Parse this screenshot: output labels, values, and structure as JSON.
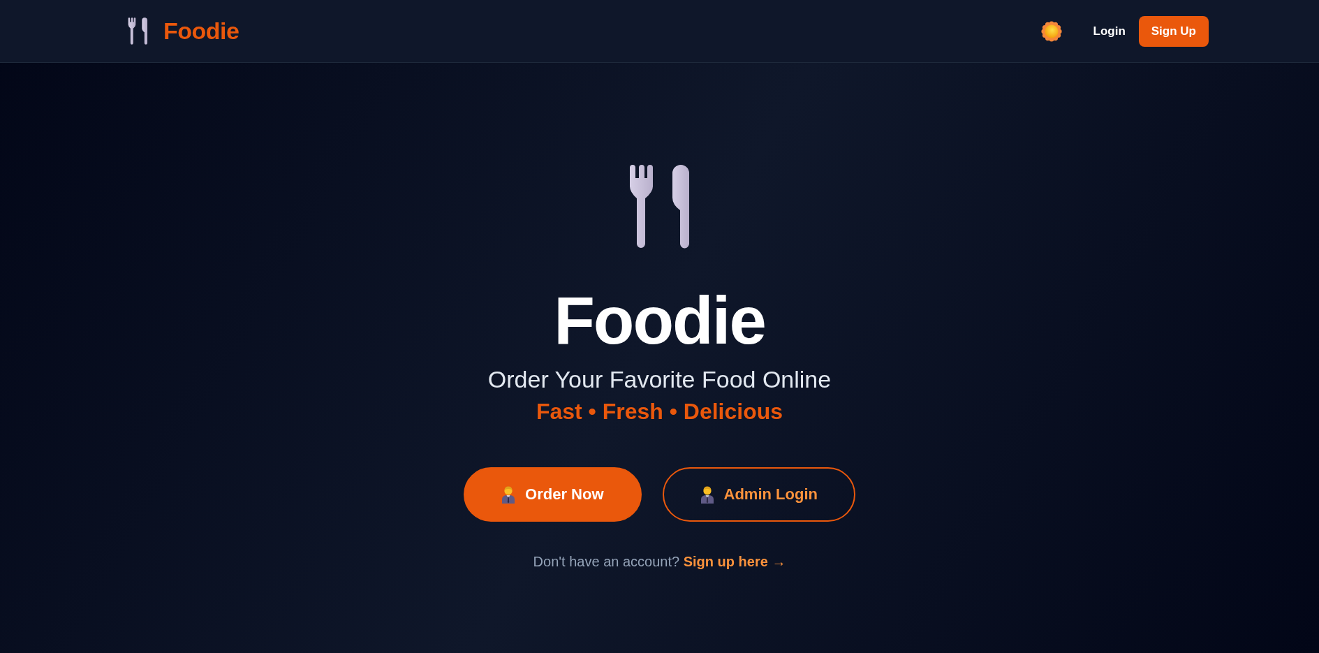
{
  "header": {
    "logo": "Foodie",
    "nav": [
      {
        "label": "Login",
        "kind": "link"
      },
      {
        "label": "Sign Up",
        "kind": "button"
      }
    ]
  },
  "hero": {
    "title": "Foodie",
    "subtitle": "Order Your Favorite Food Online",
    "tagline": "Fast • Fresh • Delicious",
    "buttons": [
      {
        "label": "Order Now",
        "kind": "primary"
      },
      {
        "label": "Admin Login",
        "kind": "outline"
      }
    ],
    "signup_prompt": {
      "text": "Don't have an account?",
      "link": "Sign up here →"
    }
  }
}
